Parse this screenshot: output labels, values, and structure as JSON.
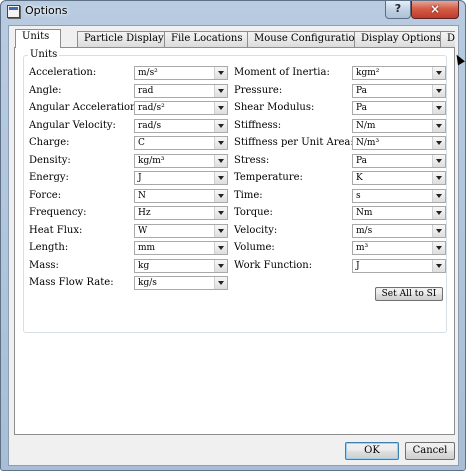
{
  "window": {
    "title": "Options",
    "help_label": "?",
    "close_label": "×"
  },
  "tabs": [
    {
      "label": "Units",
      "active": true
    },
    {
      "label": "Particle Display",
      "active": false
    },
    {
      "label": "File Locations",
      "active": false
    },
    {
      "label": "Mouse Configuration",
      "active": false
    },
    {
      "label": "Display Options",
      "active": false
    },
    {
      "label": "Data",
      "active": false
    }
  ],
  "tab_scroll_icon": "triangle-right",
  "units_group": {
    "title": "Units",
    "left": [
      {
        "label": "Acceleration:",
        "value": "m/s²"
      },
      {
        "label": "Angle:",
        "value": "rad"
      },
      {
        "label": "Angular Acceleration:",
        "value": "rad/s²"
      },
      {
        "label": "Angular Velocity:",
        "value": "rad/s"
      },
      {
        "label": "Charge:",
        "value": "C"
      },
      {
        "label": "Density:",
        "value": "kg/m³"
      },
      {
        "label": "Energy:",
        "value": "J"
      },
      {
        "label": "Force:",
        "value": "N"
      },
      {
        "label": "Frequency:",
        "value": "Hz"
      },
      {
        "label": "Heat Flux:",
        "value": "W"
      },
      {
        "label": "Length:",
        "value": "mm"
      },
      {
        "label": "Mass:",
        "value": "kg"
      },
      {
        "label": "Mass Flow Rate:",
        "value": "kg/s"
      }
    ],
    "right": [
      {
        "label": "Moment of Inertia:",
        "value": "kgm²"
      },
      {
        "label": "Pressure:",
        "value": "Pa"
      },
      {
        "label": "Shear Modulus:",
        "value": "Pa"
      },
      {
        "label": "Stiffness:",
        "value": "N/m"
      },
      {
        "label": "Stiffness per Unit Area:",
        "value": "N/m³"
      },
      {
        "label": "Stress:",
        "value": "Pa"
      },
      {
        "label": "Temperature:",
        "value": "K"
      },
      {
        "label": "Time:",
        "value": "s"
      },
      {
        "label": "Torque:",
        "value": "Nm"
      },
      {
        "label": "Velocity:",
        "value": "m/s"
      },
      {
        "label": "Volume:",
        "value": "m³"
      },
      {
        "label": "Work Function:",
        "value": "J"
      }
    ],
    "set_all_si_label": "Set All to SI"
  },
  "footer": {
    "ok_label": "OK",
    "cancel_label": "Cancel"
  },
  "colors": {
    "title_bar": "#b8cbe0",
    "close_button": "#c1392b",
    "dialog_bg": "#f0f0f0",
    "ok_focus": "#3c7fb1"
  }
}
